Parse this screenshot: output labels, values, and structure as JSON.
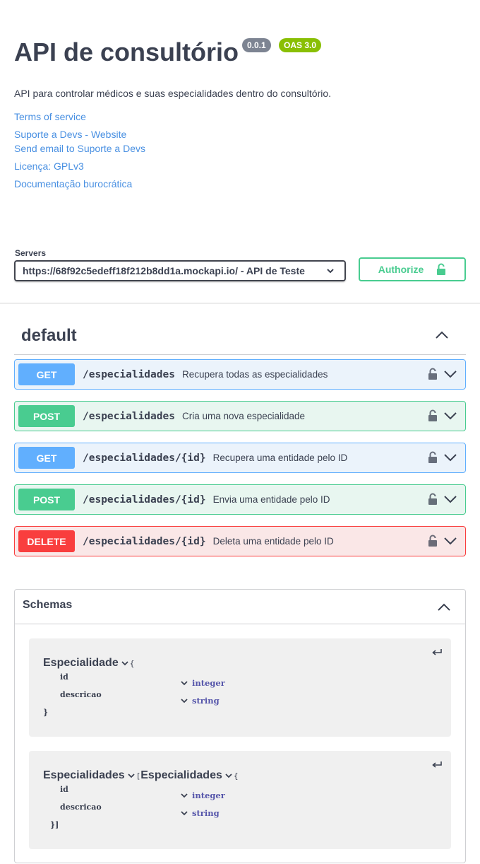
{
  "info": {
    "title": "API de consultório",
    "version": "0.0.1",
    "oas": "OAS 3.0",
    "description": "API para controlar médicos e suas especialidades dentro do consultório.",
    "links": {
      "terms": "Terms of service",
      "website": "Suporte a Devs - Website",
      "email": "Send email to Suporte a Devs",
      "license": "Licença: GPLv3",
      "docs": "Documentação burocrática"
    }
  },
  "servers": {
    "label": "Servers",
    "selected": "https://68f92c5edeff18f212b8dd1a.mockapi.io/ - API de Teste"
  },
  "authorize": {
    "label": "Authorize"
  },
  "tag": {
    "name": "default"
  },
  "operations": [
    {
      "method": "GET",
      "path": "/especialidades",
      "summary": "Recupera todas as especialidades"
    },
    {
      "method": "POST",
      "path": "/especialidades",
      "summary": "Cria uma nova especialidade"
    },
    {
      "method": "GET",
      "path": "/especialidades/{id}",
      "summary": "Recupera uma entidade pelo ID"
    },
    {
      "method": "POST",
      "path": "/especialidades/{id}",
      "summary": "Envia uma entidade pelo ID"
    },
    {
      "method": "DELETE",
      "path": "/especialidades/{id}",
      "summary": "Deleta uma entidade pelo ID"
    }
  ],
  "schemas": {
    "title": "Schemas",
    "models": [
      {
        "name": "Especialidade",
        "open": "{",
        "close": "}",
        "props": [
          {
            "name": "id",
            "type": "integer"
          },
          {
            "name": "descricao",
            "type": "string"
          }
        ]
      },
      {
        "name": "Especialidades",
        "inner": "Especialidades",
        "open_array": "[",
        "open": "{",
        "close": "}]",
        "props": [
          {
            "name": "id",
            "type": "integer"
          },
          {
            "name": "descricao",
            "type": "string"
          }
        ]
      }
    ]
  }
}
